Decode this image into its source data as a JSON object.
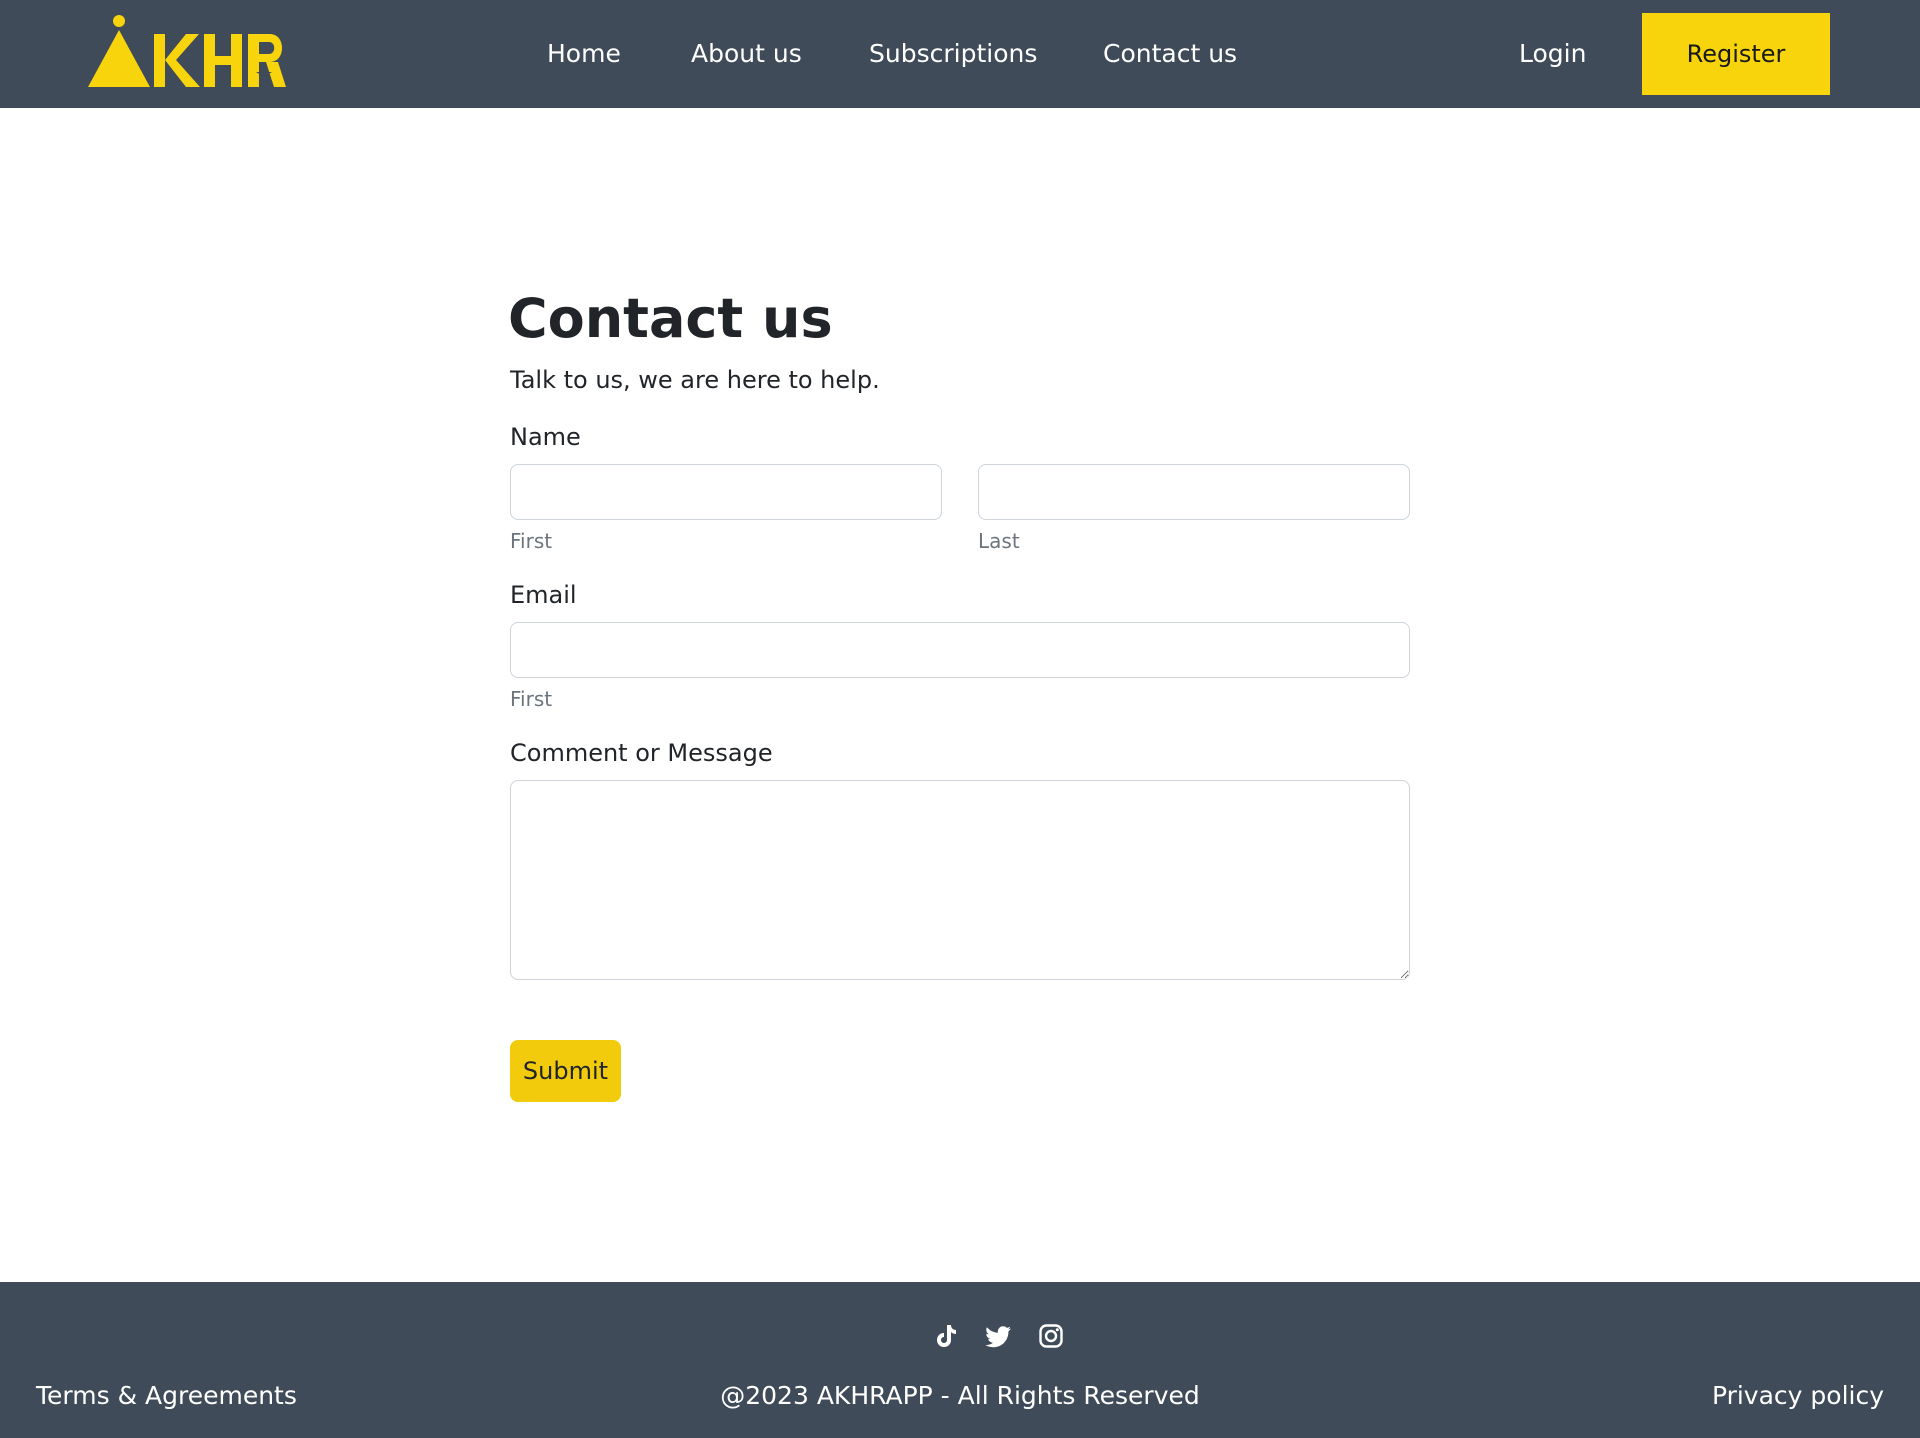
{
  "header": {
    "logo_text": "AKHR",
    "nav": [
      {
        "label": "Home"
      },
      {
        "label": "About us"
      },
      {
        "label": "Subscriptions"
      },
      {
        "label": "Contact us"
      }
    ],
    "login_label": "Login",
    "register_label": "Register"
  },
  "main": {
    "title": "Contact us",
    "subtitle": "Talk to us, we are here to help.",
    "name_label": "Name",
    "first_sublabel": "First",
    "last_sublabel": "Last",
    "email_label": "Email",
    "email_sublabel": "First",
    "message_label": "Comment or Message",
    "submit_label": "Submit",
    "first_name_value": "",
    "last_name_value": "",
    "email_value": "",
    "message_value": ""
  },
  "footer": {
    "social": [
      "tiktok-icon",
      "twitter-icon",
      "instagram-icon"
    ],
    "terms_label": "Terms & Agreements",
    "copyright": "@2023 AKHRAPP - All Rights Reserved",
    "privacy_label": "Privacy policy"
  },
  "colors": {
    "header_bg": "#404b5a",
    "accent": "#f7d40b",
    "footer_bg": "#404b5a"
  }
}
